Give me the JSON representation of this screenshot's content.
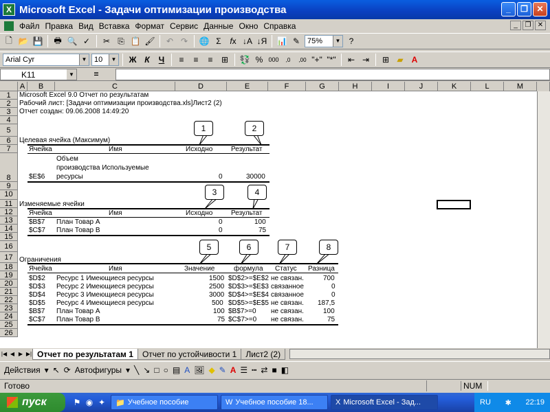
{
  "window": {
    "title": "Microsoft Excel - Задачи оптимизации производства",
    "logo": "X"
  },
  "menu": {
    "items": [
      "Файл",
      "Правка",
      "Вид",
      "Вставка",
      "Формат",
      "Сервис",
      "Данные",
      "Окно",
      "Справка"
    ]
  },
  "toolbar": {
    "zoom": "75%"
  },
  "format_toolbar": {
    "font": "Arial Cyr",
    "size": "10",
    "bold": "Ж",
    "italic": "К",
    "underline": "Ч"
  },
  "formula_bar": {
    "name_box": "K11",
    "eq": "="
  },
  "columns": [
    "A",
    "B",
    "C",
    "D",
    "E",
    "F",
    "G",
    "H",
    "I",
    "J",
    "K",
    "L",
    "M"
  ],
  "rows": [
    "1",
    "2",
    "3",
    "4",
    "5",
    "6",
    "7",
    "8",
    "9",
    "10",
    "11",
    "12",
    "13",
    "14",
    "15",
    "16",
    "17",
    "18",
    "19",
    "20",
    "21",
    "22",
    "23",
    "24",
    "25",
    "26"
  ],
  "report": {
    "line1": "Microsoft Excel 9.0 Отчет по результатам",
    "line2": "Рабочий лист: [Задачи оптимизации производства.xls]Лист2 (2)",
    "line3": "Отчет создан: 09.06.2008 14:49:20",
    "target_title": "Целевая ячейка (Максимум)",
    "hdr_cell": "Ячейка",
    "hdr_name": "Имя",
    "hdr_initial": "Исходно",
    "hdr_result": "Результат",
    "target_name_1": "Объем",
    "target_name_2": "производства Используемые",
    "target_name_3": "ресурсы",
    "target_cell": "$E$6",
    "target_initial": "0",
    "target_result": "30000",
    "changing_title": "Изменяемые ячейки",
    "changing": [
      {
        "cell": "$B$7",
        "name": "План Товар A",
        "initial": "0",
        "result": "100"
      },
      {
        "cell": "$C$7",
        "name": "План Товар B",
        "initial": "0",
        "result": "75"
      }
    ],
    "constraints_title": "Ограничения",
    "hdr_value": "Значение",
    "hdr_formula": "формула",
    "hdr_status": "Статус",
    "hdr_diff": "Разница",
    "constraints": [
      {
        "cell": "$D$2",
        "name": "Ресурс 1 Имеющиеся ресурсы",
        "value": "1500",
        "formula": "$D$2>=$E$2",
        "status": "не связан.",
        "diff": "700"
      },
      {
        "cell": "$D$3",
        "name": "Ресурс 2 Имеющиеся ресурсы",
        "value": "2500",
        "formula": "$D$3>=$E$3",
        "status": "связанное",
        "diff": "0"
      },
      {
        "cell": "$D$4",
        "name": "Ресурс 3 Имеющиеся ресурсы",
        "value": "3000",
        "formula": "$D$4>=$E$4",
        "status": "связанное",
        "diff": "0"
      },
      {
        "cell": "$D$5",
        "name": "Ресурс 4 Имеющиеся ресурсы",
        "value": "500",
        "formula": "$D$5>=$E$5",
        "status": "не связан.",
        "diff": "187,5"
      },
      {
        "cell": "$B$7",
        "name": "План Товар A",
        "value": "100",
        "formula": "$B$7>=0",
        "status": "не связан.",
        "diff": "100"
      },
      {
        "cell": "$C$7",
        "name": "План Товар B",
        "value": "75",
        "formula": "$C$7>=0",
        "status": "не связан.",
        "diff": "75"
      }
    ]
  },
  "callouts": [
    "1",
    "2",
    "3",
    "4",
    "5",
    "6",
    "7",
    "8"
  ],
  "sheets": [
    "Отчет по результатам 1",
    "Отчет по устойчивости 1",
    "Лист2 (2)"
  ],
  "drawing": {
    "actions": "Действия",
    "autoshapes": "Автофигуры"
  },
  "status": {
    "ready": "Готово",
    "num": "NUM"
  },
  "taskbar": {
    "start": "пуск",
    "items": [
      "Учебное пособие",
      "Учебное пособие 18...",
      "Microsoft Excel - Зад..."
    ],
    "lang": "RU",
    "time": "22:19"
  }
}
